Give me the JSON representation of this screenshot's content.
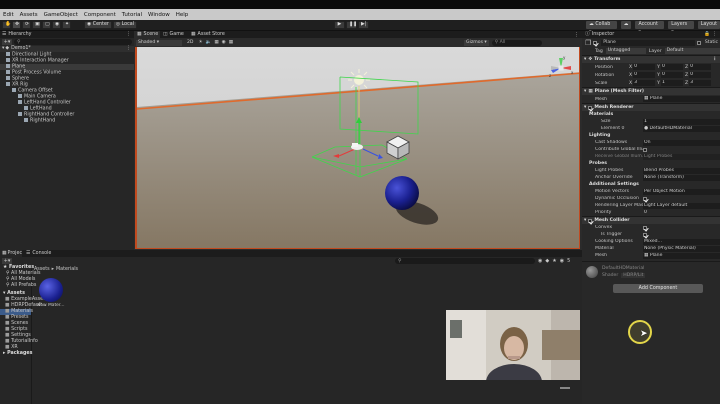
{
  "menu": [
    "Edit",
    "Assets",
    "GameObject",
    "Component",
    "Tutorial",
    "Window",
    "Help"
  ],
  "toolbar": {
    "left_buttons": [
      "Center",
      "Local"
    ],
    "collab": "Collab",
    "account": "Account",
    "layers": "Layers",
    "layout": "Layout"
  },
  "hierarchy": {
    "tab": "Hierarchy",
    "scene": "Demo1*",
    "items": [
      {
        "label": "Directional Light",
        "depth": 1,
        "selected": false
      },
      {
        "label": "XR Interaction Manager",
        "depth": 1,
        "selected": false
      },
      {
        "label": "Plane",
        "depth": 1,
        "selected": true
      },
      {
        "label": "Post Process Volume",
        "depth": 1,
        "selected": false
      },
      {
        "label": "Sphere",
        "depth": 1,
        "selected": false
      },
      {
        "label": "XR Rig",
        "depth": 1,
        "selected": false
      },
      {
        "label": "Camera Offset",
        "depth": 2,
        "selected": false
      },
      {
        "label": "Main Camera",
        "depth": 3,
        "selected": false
      },
      {
        "label": "LeftHand Controller",
        "depth": 3,
        "selected": false
      },
      {
        "label": "LeftHand",
        "depth": 4,
        "selected": false
      },
      {
        "label": "RightHand Controller",
        "depth": 3,
        "selected": false
      },
      {
        "label": "RightHand",
        "depth": 4,
        "selected": false
      }
    ]
  },
  "scene": {
    "tabs": [
      "Scene",
      "Game",
      "Asset Store"
    ],
    "shading": "Shaded",
    "mode_2d": "2D",
    "gizmos": "Gizmos",
    "search_placeholder": "All",
    "axis_labels": {
      "y": "y",
      "x": "x",
      "z": "z"
    }
  },
  "project": {
    "tabs": [
      "Project",
      "Console"
    ],
    "favorites_title": "Favorites",
    "favorites": [
      "All Materials",
      "All Models",
      "All Prefabs"
    ],
    "assets_title": "Assets",
    "assets": [
      "ExampleAssets",
      "HDRPDefault...",
      "Materials",
      "Presets",
      "Scenes",
      "Scripts",
      "Settings",
      "TutorialInfo",
      "XR"
    ],
    "packages": "Packages",
    "breadcrumb": [
      "Assets",
      "Materials"
    ],
    "asset_items": [
      {
        "label": "New Mater..."
      }
    ],
    "count": "5"
  },
  "inspector": {
    "tab": "Inspector",
    "object_name": "Plane",
    "static_label": "Static",
    "tag_label": "Tag",
    "tag_value": "Untagged",
    "layer_label": "Layer",
    "layer_value": "Default",
    "transform": {
      "title": "Transform",
      "rows": [
        {
          "label": "Position",
          "x": "0",
          "y": "0",
          "z": "0"
        },
        {
          "label": "Rotation",
          "x": "0",
          "y": "0",
          "z": "0"
        },
        {
          "label": "Scale",
          "x": "3",
          "y": "1",
          "z": "3"
        }
      ]
    },
    "mesh_filter": {
      "title": "Plane (Mesh Filter)",
      "mesh_label": "Mesh",
      "mesh_value": "Plane"
    },
    "mesh_renderer": {
      "title": "Mesh Renderer",
      "materials_label": "Materials",
      "size_label": "Size",
      "size_value": "1",
      "element_label": "Element 0",
      "element_value": "DefaultHDMaterial",
      "lighting_label": "Lighting",
      "cast_label": "Cast Shadows",
      "cast_value": "On",
      "contribute_label": "Contribute Global Illu...",
      "receive_label": "Receive Global Illum.",
      "receive_value": "Light Probes",
      "probes_label": "Probes",
      "light_probes_label": "Light Probes",
      "light_probes_value": "Blend Probes",
      "anchor_label": "Anchor Override",
      "anchor_value": "None (Transform)",
      "additional_label": "Additional Settings",
      "motion_label": "Motion Vectors",
      "motion_value": "Per Object Motion",
      "occlusion_label": "Dynamic Occlusion",
      "rendering_layer_label": "Rendering Layer Mas",
      "rendering_layer_value": "Light Layer default",
      "priority_label": "Priority",
      "priority_value": "0"
    },
    "mesh_collider": {
      "title": "Mesh Collider",
      "convex_label": "Convex",
      "trigger_label": "Is Trigger",
      "cooking_label": "Cooking Options",
      "cooking_value": "Mixed...",
      "material_label": "Material",
      "material_value": "None (Physic Material)",
      "mesh_label": "Mesh",
      "mesh_value": "Plane"
    },
    "material_preview": {
      "name": "DefaultHDMaterial",
      "shader_label": "Shader",
      "shader_value": "HDRP/Lit"
    },
    "add_component": "Add Component"
  },
  "colors": {
    "accent_select": "#3b5b8a",
    "scene_outline": "#c14a1f",
    "play_icon": "#c8c8c8"
  }
}
